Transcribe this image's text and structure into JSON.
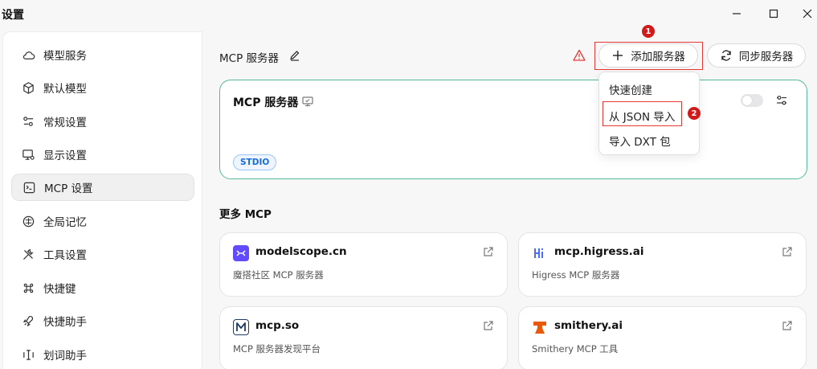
{
  "window": {
    "title": "设置",
    "controls": [
      "minimize-icon",
      "maximize-icon",
      "close-icon"
    ]
  },
  "sidebar": {
    "items": [
      {
        "label": "模型服务",
        "icon": "cloud-icon",
        "active": false
      },
      {
        "label": "默认模型",
        "icon": "cube-icon",
        "active": false
      },
      {
        "label": "常规设置",
        "icon": "sliders-icon",
        "active": false
      },
      {
        "label": "显示设置",
        "icon": "monitor-gear-icon",
        "active": false
      },
      {
        "label": "MCP 设置",
        "icon": "terminal-icon",
        "active": true
      },
      {
        "label": "全局记忆",
        "icon": "memory-icon",
        "active": false
      },
      {
        "label": "工具设置",
        "icon": "tools-icon",
        "active": false
      },
      {
        "label": "快捷键",
        "icon": "command-icon",
        "active": false
      },
      {
        "label": "快捷助手",
        "icon": "rocket-icon",
        "active": false
      },
      {
        "label": "划词助手",
        "icon": "text-cursor-icon",
        "active": false
      }
    ]
  },
  "header": {
    "title": "MCP 服务器",
    "add_button": "添加服务器",
    "sync_button": "同步服务器",
    "badge_add": "1",
    "badge_json": "2"
  },
  "dropdown": {
    "items": [
      "快速创建",
      "从 JSON 导入",
      "导入 DXT 包"
    ]
  },
  "server_card": {
    "name": "MCP 服务器",
    "tag": "STDIO",
    "enabled": false
  },
  "more": {
    "title": "更多 MCP",
    "cards": [
      {
        "name": "modelscope.cn",
        "desc": "魔搭社区 MCP 服务器",
        "logo_color": "#624aff"
      },
      {
        "name": "mcp.higress.ai",
        "desc": "Higress MCP 服务器",
        "logo_color": "#4b6bfb"
      },
      {
        "name": "mcp.so",
        "desc": "MCP 服务器发现平台",
        "logo_color": "#1f3a66"
      },
      {
        "name": "smithery.ai",
        "desc": "Smithery MCP 工具",
        "logo_color": "#e8590c"
      }
    ]
  },
  "colors": {
    "accent_green": "#55b89a",
    "tag_blue": "#1a6dd6",
    "highlight_red": "#e53935",
    "badge_red": "#d11a1a"
  }
}
